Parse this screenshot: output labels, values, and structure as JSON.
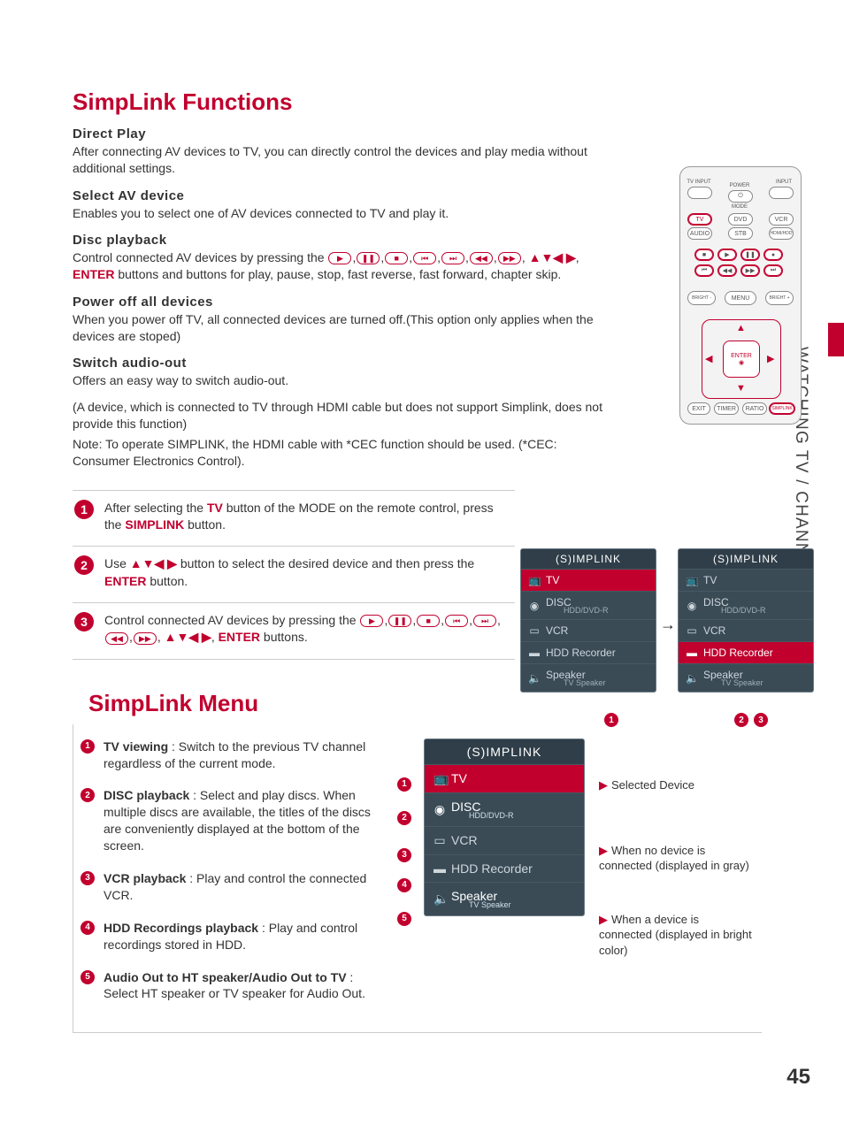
{
  "page_number": "45",
  "side_title": "WATCHING TV / CHANNEL CONTROL",
  "h1_functions": "SimpLink Functions",
  "h1_menu": "SimpLink Menu",
  "direct_play": {
    "h": "Direct Play",
    "b": "After connecting AV devices to TV, you can directly control the devices and play media without additional settings."
  },
  "select_av": {
    "h": "Select AV device",
    "b": "Enables you to select one of AV devices connected to TV and play it."
  },
  "disc_pb": {
    "h": "Disc playback",
    "pre": "Control connected AV devices by pressing the ",
    "post": " buttons and buttons for play, pause, stop, fast reverse, fast forward, chapter skip.",
    "enter": "ENTER"
  },
  "power_off": {
    "h": "Power off all devices",
    "b": "When you power off TV, all connected devices are turned off.(This option only applies when the devices are stoped)"
  },
  "switch_audio": {
    "h": "Switch audio-out",
    "b": "Offers an easy way to switch audio-out."
  },
  "note1": "(A device, which is connected to TV through HDMI cable but does not support Simplink, does not provide this function)",
  "note2": "Note: To operate SIMPLINK, the HDMI cable with *CEC function should be used. (*CEC: Consumer Electronics Control).",
  "step1a": "After selecting the ",
  "step1tv": "TV",
  "step1b": " button of the MODE on the remote control, press the ",
  "step1simp": "SIMPLINK",
  "step1c": " button.",
  "step2a": "Use ",
  "step2b": " button to select the desired device and then press the ",
  "step2c": " button.",
  "step2enter": "ENTER",
  "step3a": "Control connected AV devices by pressing the ",
  "step3b": " buttons.",
  "step3enter": "ENTER",
  "triangles": "▲▼◀ ▶",
  "simp_brand": "(S)IMPLINK",
  "panel_rows": {
    "tv": "TV",
    "disc": "DISC",
    "disc_sub": "HDD/DVD-R",
    "vcr": "VCR",
    "hdd": "HDD Recorder",
    "spk": "Speaker",
    "spk_sub": "TV Speaker"
  },
  "menu_items": [
    {
      "h": "TV viewing",
      "b": " : Switch to the previous TV channel regardless of the current mode."
    },
    {
      "h": "DISC playback",
      "b": " : Select and play discs. When multiple discs are available, the titles of the discs are conveniently displayed at the bottom of the screen."
    },
    {
      "h": "VCR playback",
      "b": " : Play and control the connected VCR."
    },
    {
      "h": "HDD Recordings playback",
      "b": " : Play and control recordings stored in HDD."
    },
    {
      "h": "Audio Out to HT speaker/Audio Out to TV",
      "b": " : Select HT speaker or TV speaker for Audio Out."
    }
  ],
  "callouts": {
    "c1": "Selected  Device",
    "c2": "When no device is connected (displayed in gray)",
    "c3": "When a device is connected (displayed in bright color)"
  },
  "remote": {
    "tvinput": "TV INPUT",
    "input": "INPUT",
    "power": "POWER",
    "mode": "MODE",
    "tv": "TV",
    "dvd": "DVD",
    "vcr": "VCR",
    "audio": "AUDIO",
    "stb": "STB",
    "hdmihdd": "HDMI/HDD",
    "bright_m": "BRIGHT -",
    "menu": "MENU",
    "bright_p": "BRIGHT +",
    "exit": "EXIT",
    "timer": "TIMER",
    "ratio": "RATIO",
    "simplink": "SIMPLINK",
    "enter": "ENTER"
  }
}
